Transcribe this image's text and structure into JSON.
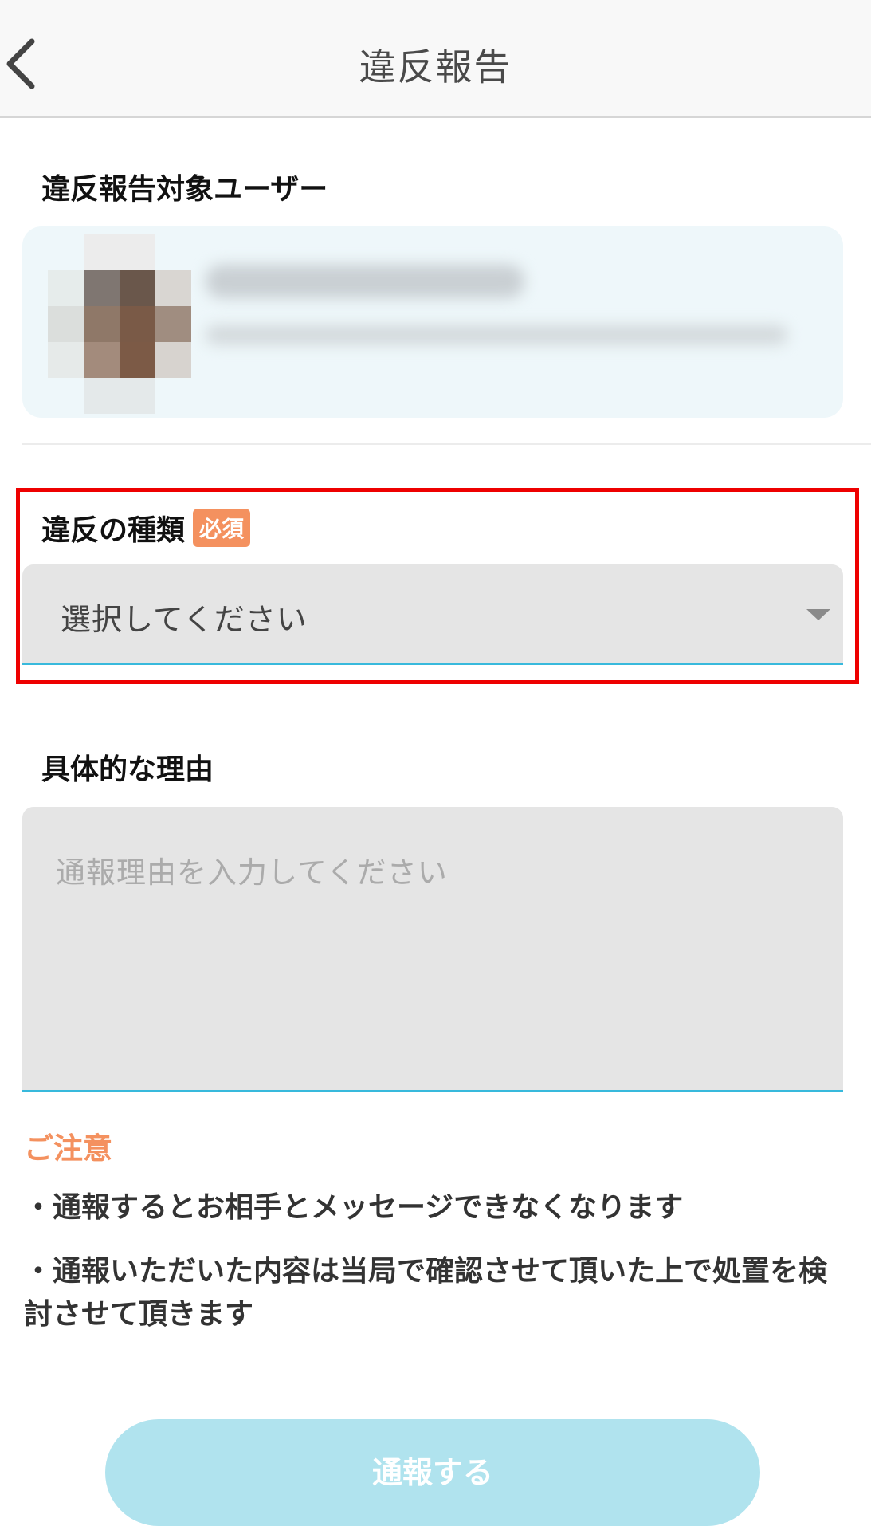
{
  "header": {
    "title": "違反報告",
    "back_icon": "chevron-left-icon"
  },
  "target_user": {
    "label": "違反報告対象ユーザー"
  },
  "violation_type": {
    "label": "違反の種類",
    "required_badge": "必須",
    "selected_value": "選択してください"
  },
  "reason": {
    "label": "具体的な理由",
    "placeholder": "通報理由を入力してください"
  },
  "caution": {
    "title": "ご注意",
    "notes": [
      "・通報するとお相手とメッセージできなくなります",
      "・通報いただいた内容は当局で確認させて頂いた上で処置を検討させて頂きます"
    ]
  },
  "submit": {
    "label": "通報する"
  },
  "colors": {
    "accent": "#38b9dc",
    "badge": "#f4915f",
    "caution": "#f4915f",
    "highlight": "#ee0000",
    "submit_disabled": "#b0e3ee"
  }
}
